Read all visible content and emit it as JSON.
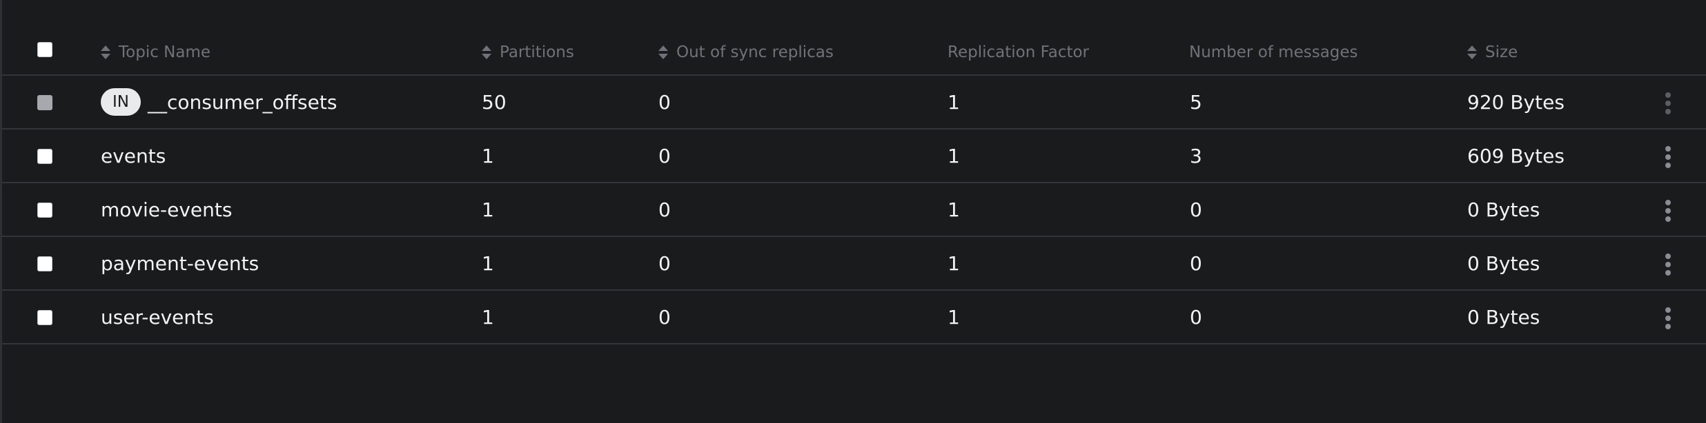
{
  "header": {
    "columns": [
      {
        "label": "Topic Name",
        "sortable": true
      },
      {
        "label": "Partitions",
        "sortable": true
      },
      {
        "label": "Out of sync replicas",
        "sortable": true
      },
      {
        "label": "Replication Factor",
        "sortable": false
      },
      {
        "label": "Number of messages",
        "sortable": false
      },
      {
        "label": "Size",
        "sortable": true
      }
    ]
  },
  "rows": [
    {
      "badge": "IN",
      "name": "__consumer_offsets",
      "partitions": "50",
      "out_of_sync": "0",
      "replication_factor": "1",
      "messages": "5",
      "size": "920 Bytes",
      "checkbox_disabled": true
    },
    {
      "badge": "",
      "name": "events",
      "partitions": "1",
      "out_of_sync": "0",
      "replication_factor": "1",
      "messages": "3",
      "size": "609 Bytes",
      "checkbox_disabled": false
    },
    {
      "badge": "",
      "name": "movie-events",
      "partitions": "1",
      "out_of_sync": "0",
      "replication_factor": "1",
      "messages": "0",
      "size": "0 Bytes",
      "checkbox_disabled": false
    },
    {
      "badge": "",
      "name": "payment-events",
      "partitions": "1",
      "out_of_sync": "0",
      "replication_factor": "1",
      "messages": "0",
      "size": "0 Bytes",
      "checkbox_disabled": false
    },
    {
      "badge": "",
      "name": "user-events",
      "partitions": "1",
      "out_of_sync": "0",
      "replication_factor": "1",
      "messages": "0",
      "size": "0 Bytes",
      "checkbox_disabled": false
    }
  ],
  "icons": {
    "sort": "sort-icon",
    "row_menu": "kebab-menu-icon"
  },
  "colors": {
    "background": "#1a1b1d",
    "divider": "#34353a",
    "header_text": "#6f7278",
    "cell_text": "#f2f3f5",
    "badge_bg": "#e9eaec"
  }
}
